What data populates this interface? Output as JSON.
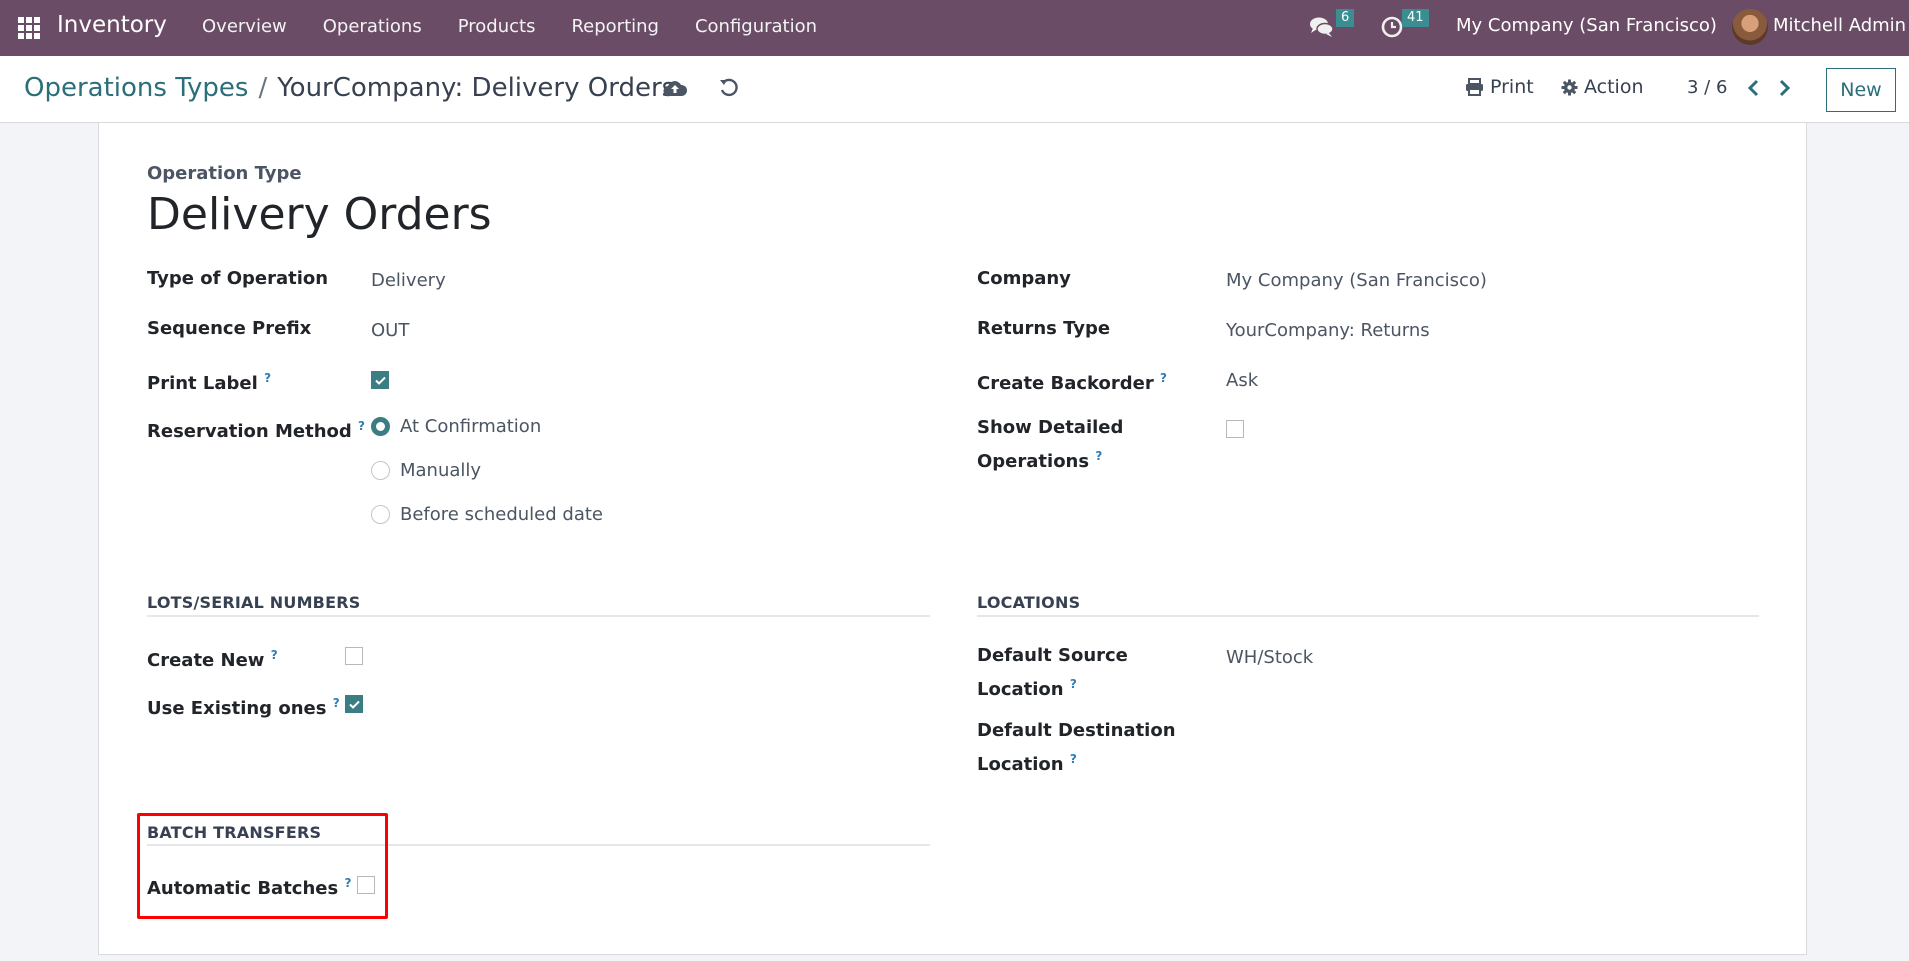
{
  "navbar": {
    "app_name": "Inventory",
    "menu": [
      "Overview",
      "Operations",
      "Products",
      "Reporting",
      "Configuration"
    ],
    "messages_count": "6",
    "activities_count": "41",
    "company": "My Company (San Francisco)",
    "user": "Mitchell Admin"
  },
  "control_panel": {
    "breadcrumb_parent": "Operations Types",
    "breadcrumb_sep": "/",
    "breadcrumb_current": "YourCompany: Delivery Orders",
    "print_label": "Print",
    "action_label": "Action",
    "pager": "3 / 6",
    "new_label": "New"
  },
  "form": {
    "title_label": "Operation Type",
    "title": "Delivery Orders",
    "left": {
      "type_of_operation": {
        "label": "Type of Operation",
        "value": "Delivery"
      },
      "sequence_prefix": {
        "label": "Sequence Prefix",
        "value": "OUT"
      },
      "print_label": {
        "label": "Print Label",
        "checked": true
      },
      "reservation_method": {
        "label": "Reservation Method",
        "options": [
          "At Confirmation",
          "Manually",
          "Before scheduled date"
        ],
        "selected": "At Confirmation"
      }
    },
    "right": {
      "company": {
        "label": "Company",
        "value": "My Company (San Francisco)"
      },
      "returns_type": {
        "label": "Returns Type",
        "value": "YourCompany: Returns"
      },
      "create_backorder": {
        "label": "Create Backorder",
        "value": "Ask"
      },
      "show_detailed_operations": {
        "label_line1": "Show Detailed",
        "label_line2": "Operations",
        "checked": false
      }
    },
    "lots": {
      "title": "LOTS/SERIAL NUMBERS",
      "create_new": {
        "label": "Create New",
        "checked": false
      },
      "use_existing": {
        "label": "Use Existing ones",
        "checked": true
      }
    },
    "locations": {
      "title": "LOCATIONS",
      "default_source": {
        "label_line1": "Default Source",
        "label_line2": "Location",
        "value": "WH/Stock"
      },
      "default_destination": {
        "label_line1": "Default Destination",
        "label_line2": "Location",
        "value": ""
      }
    },
    "batch": {
      "title": "BATCH TRANSFERS",
      "automatic_batches": {
        "label": "Automatic Batches",
        "checked": false
      }
    },
    "help_mark": "?"
  },
  "colors": {
    "navbar": "#6b4c66",
    "accent": "#3a7e84",
    "highlight": "#ff0000"
  }
}
